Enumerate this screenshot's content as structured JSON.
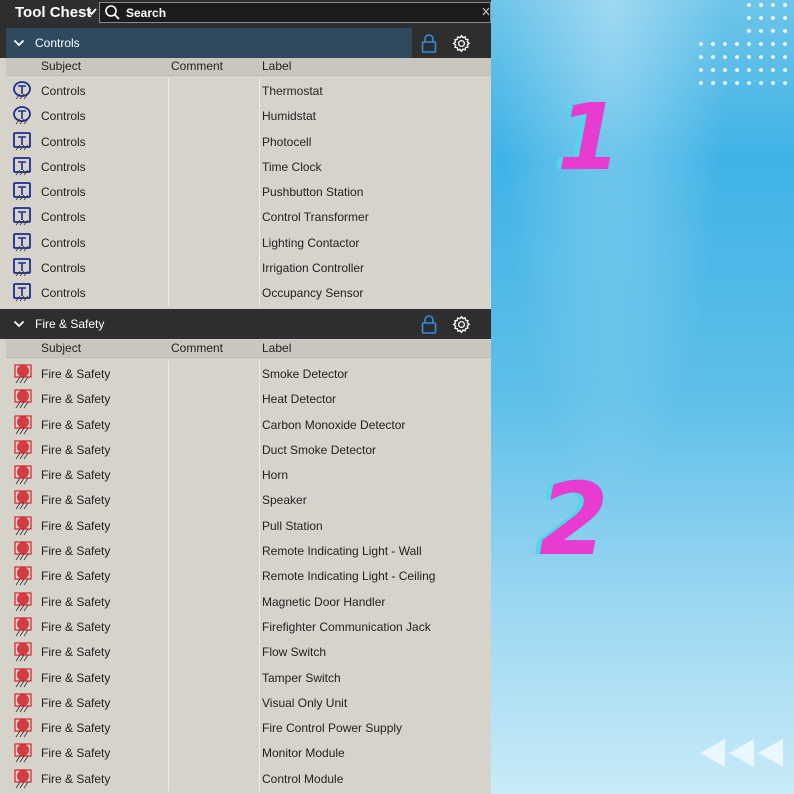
{
  "toolbar": {
    "title": "Tool Chest",
    "search_placeholder": "Search"
  },
  "columns": {
    "subject": "Subject",
    "comment": "Comment",
    "label": "Label"
  },
  "sections": [
    {
      "name": "Controls",
      "rows": [
        {
          "icon": "thermostat-icon",
          "subject": "Controls",
          "comment": "",
          "label": "Thermostat"
        },
        {
          "icon": "humidistat-icon",
          "subject": "Controls",
          "comment": "",
          "label": "Humidstat"
        },
        {
          "icon": "photocell-icon",
          "subject": "Controls",
          "comment": "",
          "label": "Photocell"
        },
        {
          "icon": "time-clock-icon",
          "subject": "Controls",
          "comment": "",
          "label": "Time Clock"
        },
        {
          "icon": "pushbutton-station-icon",
          "subject": "Controls",
          "comment": "",
          "label": "Pushbutton Station"
        },
        {
          "icon": "control-transformer-icon",
          "subject": "Controls",
          "comment": "",
          "label": "Control Transformer"
        },
        {
          "icon": "lighting-contactor-icon",
          "subject": "Controls",
          "comment": "",
          "label": "Lighting Contactor"
        },
        {
          "icon": "irrigation-controller-icon",
          "subject": "Controls",
          "comment": "",
          "label": "Irrigation Controller"
        },
        {
          "icon": "occupancy-sensor-icon",
          "subject": "Controls",
          "comment": "",
          "label": "Occupancy Sensor"
        }
      ]
    },
    {
      "name": "Fire & Safety",
      "rows": [
        {
          "icon": "smoke-detector-icon",
          "subject": "Fire & Safety",
          "comment": "",
          "label": "Smoke Detector"
        },
        {
          "icon": "heat-detector-icon",
          "subject": "Fire & Safety",
          "comment": "",
          "label": "Heat Detector"
        },
        {
          "icon": "co-detector-icon",
          "subject": "Fire & Safety",
          "comment": "",
          "label": "Carbon Monoxide Detector"
        },
        {
          "icon": "duct-smoke-detector-icon",
          "subject": "Fire & Safety",
          "comment": "",
          "label": "Duct Smoke Detector"
        },
        {
          "icon": "horn-icon",
          "subject": "Fire & Safety",
          "comment": "",
          "label": "Horn"
        },
        {
          "icon": "speaker-icon",
          "subject": "Fire & Safety",
          "comment": "",
          "label": "Speaker"
        },
        {
          "icon": "pull-station-icon",
          "subject": "Fire & Safety",
          "comment": "",
          "label": "Pull Station"
        },
        {
          "icon": "indicating-light-wall-icon",
          "subject": "Fire & Safety",
          "comment": "",
          "label": "Remote Indicating Light - Wall"
        },
        {
          "icon": "indicating-light-ceiling-icon",
          "subject": "Fire & Safety",
          "comment": "",
          "label": "Remote Indicating Light - Ceiling"
        },
        {
          "icon": "door-holder-icon",
          "subject": "Fire & Safety",
          "comment": "",
          "label": "Magnetic Door Handler"
        },
        {
          "icon": "firefighter-jack-icon",
          "subject": "Fire & Safety",
          "comment": "",
          "label": "Firefighter Communication Jack"
        },
        {
          "icon": "flow-switch-icon",
          "subject": "Fire & Safety",
          "comment": "",
          "label": "Flow Switch"
        },
        {
          "icon": "tamper-switch-icon",
          "subject": "Fire & Safety",
          "comment": "",
          "label": "Tamper Switch"
        },
        {
          "icon": "visual-unit-icon",
          "subject": "Fire & Safety",
          "comment": "",
          "label": "Visual Only Unit"
        },
        {
          "icon": "power-supply-icon",
          "subject": "Fire & Safety",
          "comment": "",
          "label": "Fire Control Power Supply"
        },
        {
          "icon": "monitor-module-icon",
          "subject": "Fire & Safety",
          "comment": "",
          "label": "Monitor Module"
        },
        {
          "icon": "control-module-icon",
          "subject": "Fire & Safety",
          "comment": "",
          "label": "Control Module"
        }
      ]
    }
  ],
  "decor": {
    "digit_1": "1",
    "digit_2": "2",
    "digit_color": "#e83bd0",
    "shadow_color": "#4fd8e8"
  },
  "colors": {
    "header_bg": "#2e2e2e",
    "active_header_bg": "#2f4a5e",
    "list_bg": "#d6d3cb",
    "lock_blue": "#2e8fe0",
    "controls_icon": "#1d2d8f",
    "fire_icon": "#d6202a"
  }
}
